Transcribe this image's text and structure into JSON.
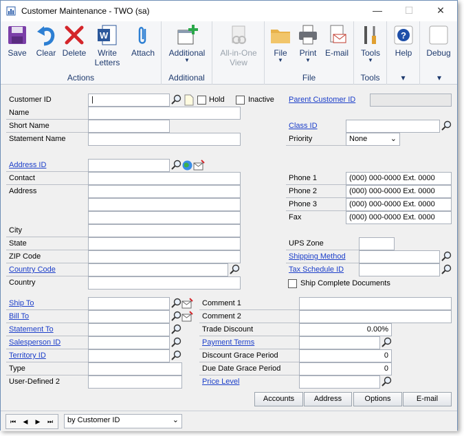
{
  "window": {
    "title": "Customer Maintenance  -  TWO (sa)",
    "minimize": "—",
    "maximize": "☐",
    "close": "✕"
  },
  "ribbon": {
    "actions": {
      "label": "Actions",
      "save": "Save",
      "clear": "Clear",
      "delete": "Delete",
      "write_letters": "Write Letters",
      "attach": "Attach"
    },
    "additional": {
      "label": "Additional",
      "additional": "Additional"
    },
    "all_in_one": {
      "label": "All-in-One View"
    },
    "file": {
      "label": "File",
      "file": "File",
      "print": "Print",
      "email": "E-mail"
    },
    "tools": {
      "label": "Tools",
      "tools": "Tools"
    },
    "help": {
      "help": "Help"
    },
    "debug": {
      "debug": "Debug"
    }
  },
  "form": {
    "customer_id": {
      "label": "Customer ID",
      "value": "|"
    },
    "hold": {
      "label": "Hold"
    },
    "inactive": {
      "label": "Inactive"
    },
    "parent_customer_id": {
      "label": "Parent Customer ID"
    },
    "name": {
      "label": "Name"
    },
    "short_name": {
      "label": "Short Name"
    },
    "statement_name": {
      "label": "Statement Name"
    },
    "class_id": {
      "label": "Class ID"
    },
    "priority": {
      "label": "Priority",
      "value": "None"
    },
    "address_id": {
      "label": "Address ID"
    },
    "contact": {
      "label": "Contact"
    },
    "address": {
      "label": "Address"
    },
    "city": {
      "label": "City"
    },
    "state": {
      "label": "State"
    },
    "zip": {
      "label": "ZIP Code"
    },
    "country_code": {
      "label": "Country Code"
    },
    "country": {
      "label": "Country"
    },
    "phone1": {
      "label": "Phone 1",
      "value": "(000) 000-0000  Ext. 0000"
    },
    "phone2": {
      "label": "Phone 2",
      "value": "(000) 000-0000  Ext. 0000"
    },
    "phone3": {
      "label": "Phone 3",
      "value": "(000) 000-0000  Ext. 0000"
    },
    "fax": {
      "label": "Fax",
      "value": "(000) 000-0000  Ext. 0000"
    },
    "ups_zone": {
      "label": "UPS Zone"
    },
    "shipping_method": {
      "label": "Shipping Method"
    },
    "tax_schedule_id": {
      "label": "Tax Schedule ID"
    },
    "ship_complete": {
      "label": "Ship Complete Documents"
    },
    "ship_to": {
      "label": "Ship To"
    },
    "bill_to": {
      "label": "Bill To"
    },
    "statement_to": {
      "label": "Statement To"
    },
    "salesperson_id": {
      "label": "Salesperson ID"
    },
    "territory_id": {
      "label": "Territory ID"
    },
    "type": {
      "label": "Type"
    },
    "user_defined_2": {
      "label": "User-Defined 2"
    },
    "comment1": {
      "label": "Comment 1"
    },
    "comment2": {
      "label": "Comment 2"
    },
    "trade_discount": {
      "label": "Trade Discount",
      "value": "0.00%"
    },
    "payment_terms": {
      "label": "Payment Terms"
    },
    "discount_grace": {
      "label": "Discount Grace Period",
      "value": "0"
    },
    "due_date_grace": {
      "label": "Due Date Grace Period",
      "value": "0"
    },
    "price_level": {
      "label": "Price Level"
    }
  },
  "buttons": {
    "accounts": "Accounts",
    "address": "Address",
    "options": "Options",
    "email": "E-mail"
  },
  "status": {
    "sort": "by Customer ID"
  },
  "colors": {
    "link": "#1a3dc9",
    "ribbon_text": "#1e3a6e"
  }
}
